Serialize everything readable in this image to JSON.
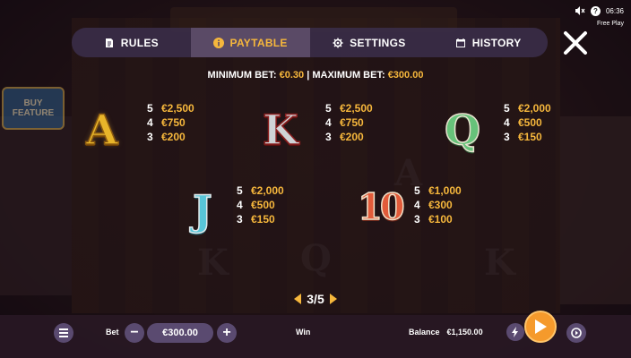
{
  "status": {
    "time": "06:36",
    "mode": "Free Play"
  },
  "background": {
    "buy_feature": "BUY FEATURE"
  },
  "tabs": [
    {
      "label": "RULES",
      "icon": "document-icon",
      "active": false
    },
    {
      "label": "PAYTABLE",
      "icon": "info-icon",
      "active": true
    },
    {
      "label": "SETTINGS",
      "icon": "gear-icon",
      "active": false
    },
    {
      "label": "HISTORY",
      "icon": "calendar-icon",
      "active": false
    }
  ],
  "limits": {
    "min_label": "MINIMUM BET:",
    "min_value": "€0.30",
    "separator": "|",
    "max_label": "MAXIMUM BET:",
    "max_value": "€300.00"
  },
  "paytable": [
    {
      "symbol": "A",
      "pays": [
        {
          "count": "5",
          "amount": "€2,500"
        },
        {
          "count": "4",
          "amount": "€750"
        },
        {
          "count": "3",
          "amount": "€200"
        }
      ]
    },
    {
      "symbol": "K",
      "pays": [
        {
          "count": "5",
          "amount": "€2,500"
        },
        {
          "count": "4",
          "amount": "€750"
        },
        {
          "count": "3",
          "amount": "€200"
        }
      ]
    },
    {
      "symbol": "Q",
      "pays": [
        {
          "count": "5",
          "amount": "€2,000"
        },
        {
          "count": "4",
          "amount": "€500"
        },
        {
          "count": "3",
          "amount": "€150"
        }
      ]
    },
    {
      "symbol": "J",
      "pays": [
        {
          "count": "5",
          "amount": "€2,000"
        },
        {
          "count": "4",
          "amount": "€500"
        },
        {
          "count": "3",
          "amount": "€150"
        }
      ]
    },
    {
      "symbol": "10",
      "pays": [
        {
          "count": "5",
          "amount": "€1,000"
        },
        {
          "count": "4",
          "amount": "€300"
        },
        {
          "count": "3",
          "amount": "€100"
        }
      ]
    }
  ],
  "pager": {
    "text": "3/5"
  },
  "bottom": {
    "bet_label": "Bet",
    "minus": "−",
    "bet_value": "€300.00",
    "plus": "+",
    "win_label": "Win",
    "balance_label": "Balance",
    "balance_value": "€1,150.00"
  },
  "colors": {
    "accent": "#f6b73c",
    "panel": "#3a2c48",
    "spin": "#f59a2c"
  }
}
